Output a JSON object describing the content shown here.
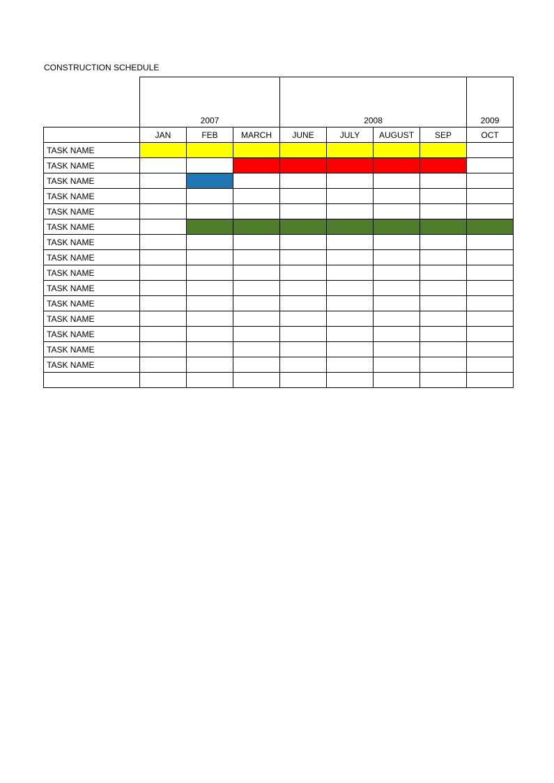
{
  "title": "CONSTRUCTION SCHEDULE",
  "years": [
    "2007",
    "2008",
    "2009"
  ],
  "months": [
    "JAN",
    "FEB",
    "MARCH",
    "JUNE",
    "JULY",
    "AUGUST",
    "SEP",
    "OCT"
  ],
  "tasks": [
    "TASK NAME",
    "TASK NAME",
    "TASK NAME",
    "TASK NAME",
    "TASK NAME",
    "TASK NAME",
    "TASK NAME",
    "TASK NAME",
    "TASK NAME",
    "TASK NAME",
    "TASK NAME",
    "TASK NAME",
    "TASK NAME",
    "TASK NAME",
    "TASK NAME"
  ],
  "colors": {
    "yellow": "#ffff00",
    "red": "#ff0000",
    "blue": "#1f77b4",
    "green": "#4f7d2b"
  },
  "chart_data": {
    "type": "table",
    "title": "CONSTRUCTION SCHEDULE",
    "columns": [
      "JAN",
      "FEB",
      "MARCH",
      "JUNE",
      "JULY",
      "AUGUST",
      "SEP",
      "OCT"
    ],
    "year_groups": [
      {
        "year": "2007",
        "span": 3
      },
      {
        "year": "2008",
        "span": 4
      },
      {
        "year": "2009",
        "span": 1
      }
    ],
    "rows": [
      {
        "task": "TASK NAME",
        "bars": [
          {
            "start": 0,
            "end": 6,
            "color": "yellow"
          }
        ]
      },
      {
        "task": "TASK NAME",
        "bars": [
          {
            "start": 2,
            "end": 6,
            "color": "red"
          }
        ]
      },
      {
        "task": "TASK NAME",
        "bars": [
          {
            "start": 1,
            "end": 1,
            "color": "blue"
          }
        ]
      },
      {
        "task": "TASK NAME",
        "bars": []
      },
      {
        "task": "TASK NAME",
        "bars": []
      },
      {
        "task": "TASK NAME",
        "bars": [
          {
            "start": 1,
            "end": 7,
            "color": "green"
          }
        ]
      },
      {
        "task": "TASK NAME",
        "bars": []
      },
      {
        "task": "TASK NAME",
        "bars": []
      },
      {
        "task": "TASK NAME",
        "bars": []
      },
      {
        "task": "TASK NAME",
        "bars": []
      },
      {
        "task": "TASK NAME",
        "bars": []
      },
      {
        "task": "TASK NAME",
        "bars": []
      },
      {
        "task": "TASK NAME",
        "bars": []
      },
      {
        "task": "TASK NAME",
        "bars": []
      },
      {
        "task": "TASK NAME",
        "bars": []
      }
    ]
  }
}
